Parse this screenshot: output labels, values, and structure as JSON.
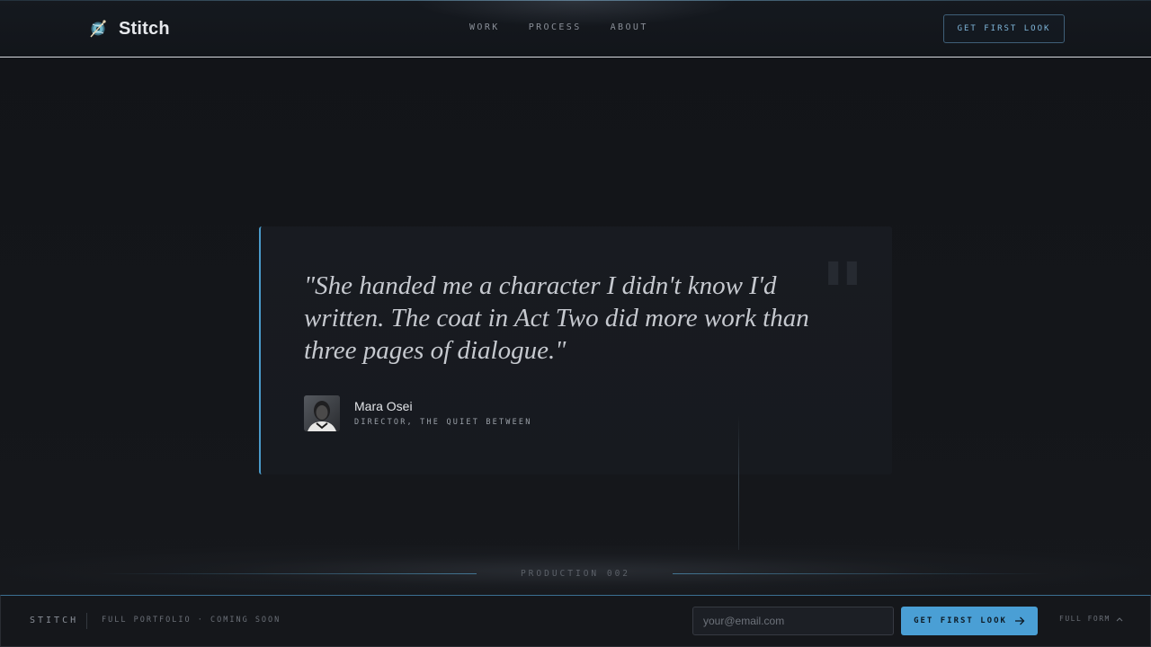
{
  "header": {
    "brand_name": "Stitch",
    "brand_icon": "spool-needle-icon",
    "nav": [
      "WORK",
      "PROCESS",
      "ABOUT"
    ],
    "cta_label": "GET FIRST LOOK"
  },
  "testimonial": {
    "quote": "\"She handed me a character I didn't know I'd written. The coat in Act Two did more work than three pages of dialogue.\"",
    "quote_mark": "\"",
    "author_name": "Mara Osei",
    "author_role": "DIRECTOR, THE QUIET BETWEEN",
    "accent_color": "#4a9ac9"
  },
  "production": {
    "label": "PRODUCTION 002"
  },
  "footer": {
    "brand": "STITCH",
    "note": "FULL PORTFOLIO · COMING SOON",
    "email_placeholder": "your@email.com",
    "email_value": "",
    "cta_label": "GET FIRST LOOK",
    "cta_icon": "arrow-right-icon",
    "full_form_label": "FULL FORM",
    "full_form_icon": "chevron-up-icon",
    "cta_color": "#4a9fd5"
  }
}
